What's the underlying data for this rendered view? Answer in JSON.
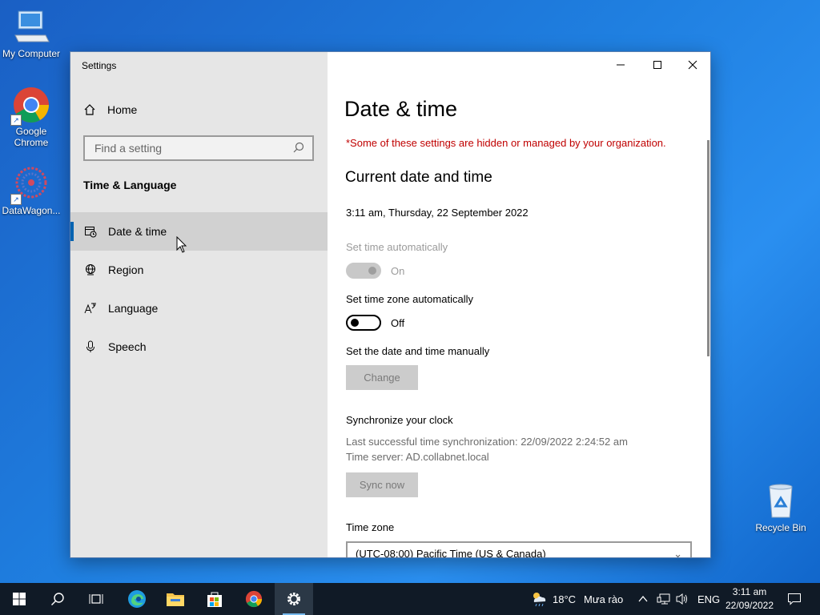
{
  "desktop": {
    "icons": [
      {
        "label": "My Computer",
        "icon": "computer-icon"
      },
      {
        "label": "Google Chrome",
        "icon": "chrome-icon"
      },
      {
        "label": "DataWagon...",
        "icon": "datawagon-icon"
      },
      {
        "label": "Recycle Bin",
        "icon": "recycle-bin-icon"
      }
    ]
  },
  "window": {
    "title": "Settings",
    "controls": {
      "minimize": "─",
      "maximize": "☐",
      "close": "✕"
    }
  },
  "sidebar": {
    "home": "Home",
    "search_placeholder": "Find a setting",
    "section": "Time & Language",
    "items": [
      {
        "label": "Date & time",
        "icon": "date-time-icon",
        "active": true
      },
      {
        "label": "Region",
        "icon": "region-icon",
        "active": false
      },
      {
        "label": "Language",
        "icon": "language-icon",
        "active": false
      },
      {
        "label": "Speech",
        "icon": "microphone-icon",
        "active": false
      }
    ]
  },
  "main": {
    "title": "Date & time",
    "org_note": "*Some of these settings are hidden or managed by your organization.",
    "current_heading": "Current date and time",
    "current_value": "3:11 am, Thursday, 22 September 2022",
    "set_time_auto": {
      "label": "Set time automatically",
      "state": "On"
    },
    "set_tz_auto": {
      "label": "Set time zone automatically",
      "state": "Off"
    },
    "manual": {
      "label": "Set the date and time manually",
      "button": "Change"
    },
    "sync": {
      "heading": "Synchronize your clock",
      "last": "Last successful time synchronization: 22/09/2022 2:24:52 am",
      "server": "Time server: AD.collabnet.local",
      "button": "Sync now"
    },
    "timezone": {
      "label": "Time zone",
      "value": "(UTC-08:00) Pacific Time (US & Canada)"
    }
  },
  "taskbar": {
    "weather": {
      "temp": "18°C",
      "desc": "Mưa rào"
    },
    "lang": "ENG",
    "time": "3:11 am",
    "date": "22/09/2022"
  },
  "colors": {
    "accent": "#0063b1",
    "warning": "#c00000",
    "taskbar": "#101a26"
  }
}
